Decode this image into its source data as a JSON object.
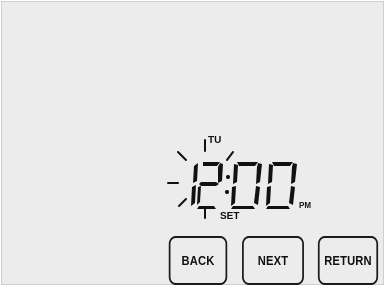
{
  "colors": {
    "panel_bg": "#ececec",
    "ink": "#111111"
  },
  "display": {
    "day": "TU",
    "hour": "12",
    "minute": "00",
    "meridiem": "PM",
    "mode_label": "SET",
    "blinking": true
  },
  "buttons": {
    "back": "BACK",
    "next": "NEXT",
    "return": "RETURN"
  }
}
